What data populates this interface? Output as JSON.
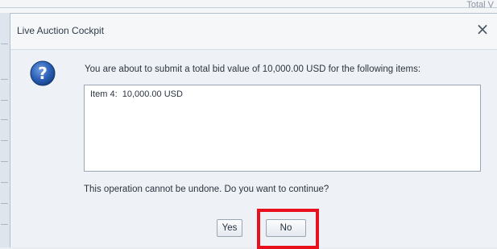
{
  "background": {
    "corner_text": "Total V"
  },
  "dialog": {
    "title": "Live Auction Cockpit",
    "close_symbol": "×",
    "icon": "question-icon",
    "message": "You are about to submit a total bid value of 10,000.00 USD for the following items:",
    "items": [
      "Item 4:  10,000.00 USD"
    ],
    "confirm_text": "This operation cannot be undone. Do you want to continue?",
    "buttons": {
      "yes_label": "Yes",
      "no_label": "No"
    }
  },
  "colors": {
    "highlight": "#e8101c",
    "question_icon": "#1f4f9a"
  }
}
